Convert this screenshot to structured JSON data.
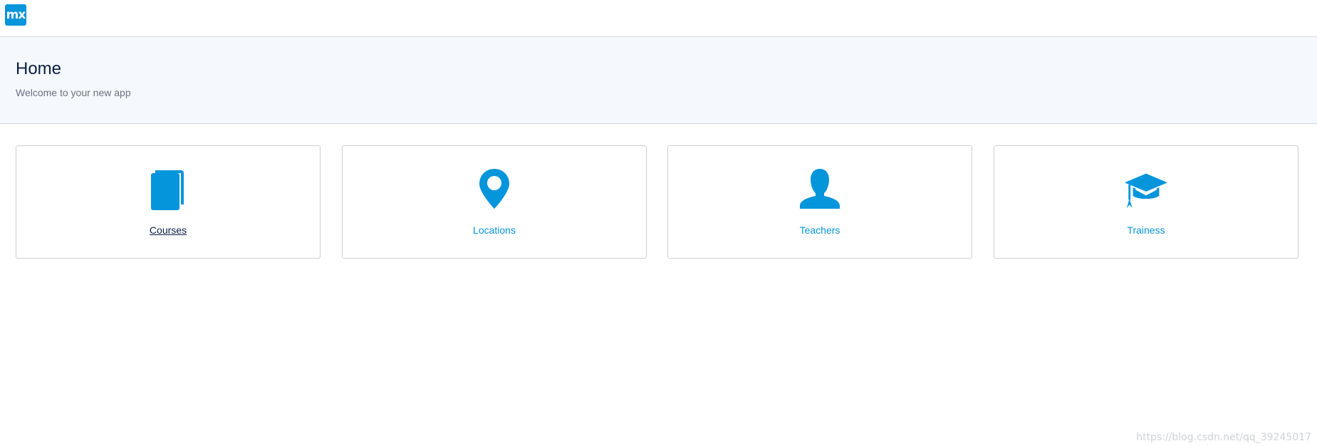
{
  "app": {
    "logo_text": "mx"
  },
  "header": {
    "title": "Home",
    "subtitle": "Welcome to your new app"
  },
  "cards": [
    {
      "label": "Courses",
      "icon": "book-icon"
    },
    {
      "label": "Locations",
      "icon": "map-pin-icon"
    },
    {
      "label": "Teachers",
      "icon": "user-icon"
    },
    {
      "label": "Trainess",
      "icon": "graduation-cap-icon"
    }
  ],
  "watermark": "https://blog.csdn.net/qq_39245017",
  "colors": {
    "brand": "#0595db",
    "title": "#0a1f44",
    "header_bg": "#f5f8fd"
  }
}
